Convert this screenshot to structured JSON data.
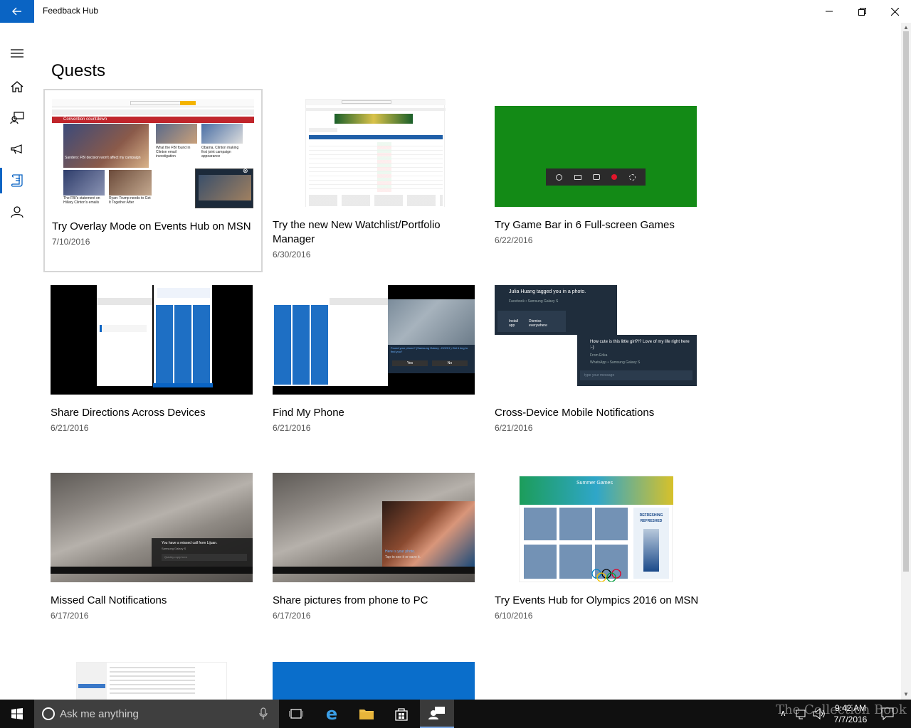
{
  "window": {
    "title": "Feedback Hub"
  },
  "nav": {
    "items": [
      "menu",
      "home",
      "feedback",
      "announcements",
      "quests",
      "profile"
    ],
    "active": "quests"
  },
  "page": {
    "title": "Quests"
  },
  "quests": [
    {
      "title": "Try Overlay Mode on Events Hub on MSN",
      "date": "7/10/2016"
    },
    {
      "title": "Try the new New Watchlist/Portfolio Manager",
      "date": "6/30/2016"
    },
    {
      "title": "Try Game Bar in 6 Full-screen Games",
      "date": "6/22/2016"
    },
    {
      "title": "Share Directions Across Devices",
      "date": "6/21/2016"
    },
    {
      "title": "Find My Phone",
      "date": "6/21/2016"
    },
    {
      "title": "Cross-Device Mobile Notifications",
      "date": "6/21/2016"
    },
    {
      "title": "Missed Call Notifications",
      "date": "6/17/2016"
    },
    {
      "title": "Share pictures from phone to PC",
      "date": "6/17/2016"
    },
    {
      "title": "Try Events Hub for Olympics 2016 on MSN",
      "date": "6/10/2016"
    }
  ],
  "thumbs": {
    "msn_headline": "Convention countdown",
    "msn_story1": "Sanders: FBI decision won't affect my campaign",
    "msn_story2": "What the FBI found in Clinton email investigation",
    "msn_story3": "Obama, Clinton making first joint campaign appearance",
    "msn_story4": "The FBI's statement on Hillary Clinton's emails",
    "msn_story5": "Ryan: Trump needs to Get It Together After",
    "notif1_title": "Julia Huang tagged you in a photo.",
    "notif1_source": "Facebook • Samsung Galaxy S",
    "notif1_action1": "Install app",
    "notif1_action2": "Dismiss everywhere",
    "notif2_title": "How cute is this little girl?!? Love of my life right here :-)",
    "notif2_from": "From Erika",
    "notif2_source": "WhatsApp • Samsung Galaxy S",
    "notif2_placeholder": "type your message",
    "findphone_prompt": "Found your phone? (Samsung Galaxy - DOOH ) Did it ring to find you?",
    "findphone_yes": "Yes",
    "findphone_no": "No",
    "missedcall_text": "You have a missed call from Lijuan.",
    "missedcall_device": "Samsung Galaxy S",
    "missedcall_reply": "Quickly reply here",
    "sharepic_text1": "Here is your photo.",
    "sharepic_text2": "Tap to see it or save it.",
    "olympics_header": "Summer Games",
    "olympics_ad1": "REFRESHING",
    "olympics_ad2": "REFRESHED"
  },
  "taskbar": {
    "search_placeholder": "Ask me anything",
    "time": "9:42 AM",
    "date": "7/7/2016",
    "watermark": "The Collection Book"
  },
  "colors": {
    "accent": "#0a64c4",
    "gamebar_green": "#138a16",
    "taskbar": "#101010"
  }
}
